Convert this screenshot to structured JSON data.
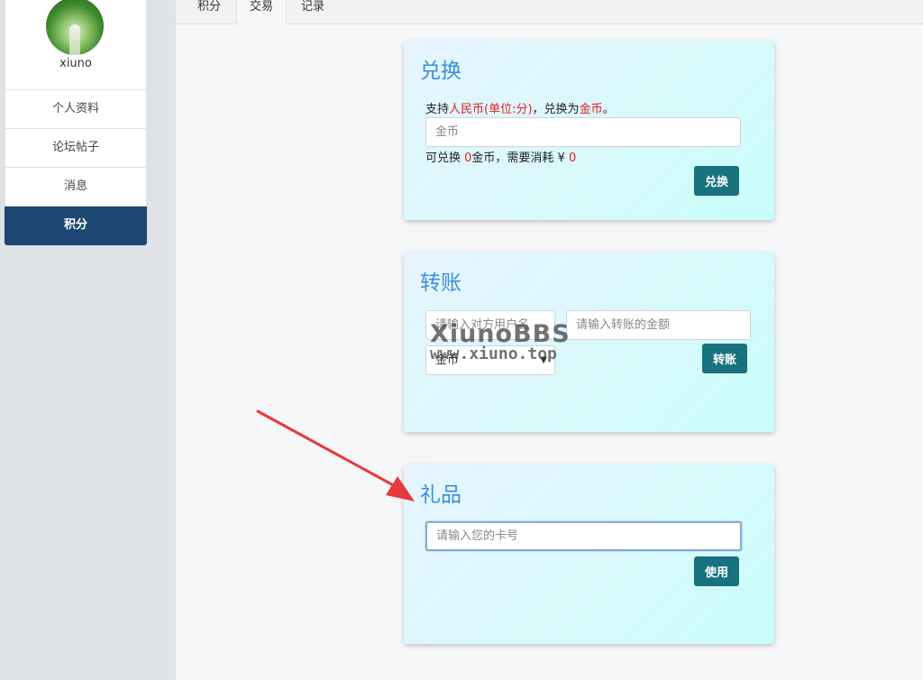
{
  "sidebar": {
    "username": "xiuno",
    "items": [
      {
        "label": "个人资料"
      },
      {
        "label": "论坛帖子"
      },
      {
        "label": "消息"
      },
      {
        "label": "积分"
      }
    ]
  },
  "tabs": [
    {
      "label": "积分"
    },
    {
      "label": "交易"
    },
    {
      "label": "记录"
    }
  ],
  "exchange": {
    "title": "兑换",
    "desc_prefix": "支持",
    "desc_currency": "人民币(单位:分)",
    "desc_middle": "，兑换为",
    "desc_target": "金币",
    "desc_suffix": "。",
    "input_placeholder": "金币",
    "note_prefix": "可兑换 ",
    "note_amount": "0",
    "note_middle": "金币，需要消耗 ¥ ",
    "note_cost": "0",
    "button": "兑换"
  },
  "transfer": {
    "title": "转账",
    "user_placeholder": "请输入对方用户名",
    "amount_placeholder": "请输入转账的金额",
    "select_value": "金币",
    "button": "转账"
  },
  "gift": {
    "title": "礼品",
    "card_placeholder": "请输入您的卡号",
    "button": "使用"
  },
  "watermark": {
    "line1": "XiunoBBS",
    "line2": "www.xiuno.top"
  },
  "colors": {
    "accent": "#17727d",
    "sidebar_active": "#1e4773",
    "title": "#3a8fd8",
    "highlight": "#e02020",
    "arrow": "#e8393c"
  }
}
